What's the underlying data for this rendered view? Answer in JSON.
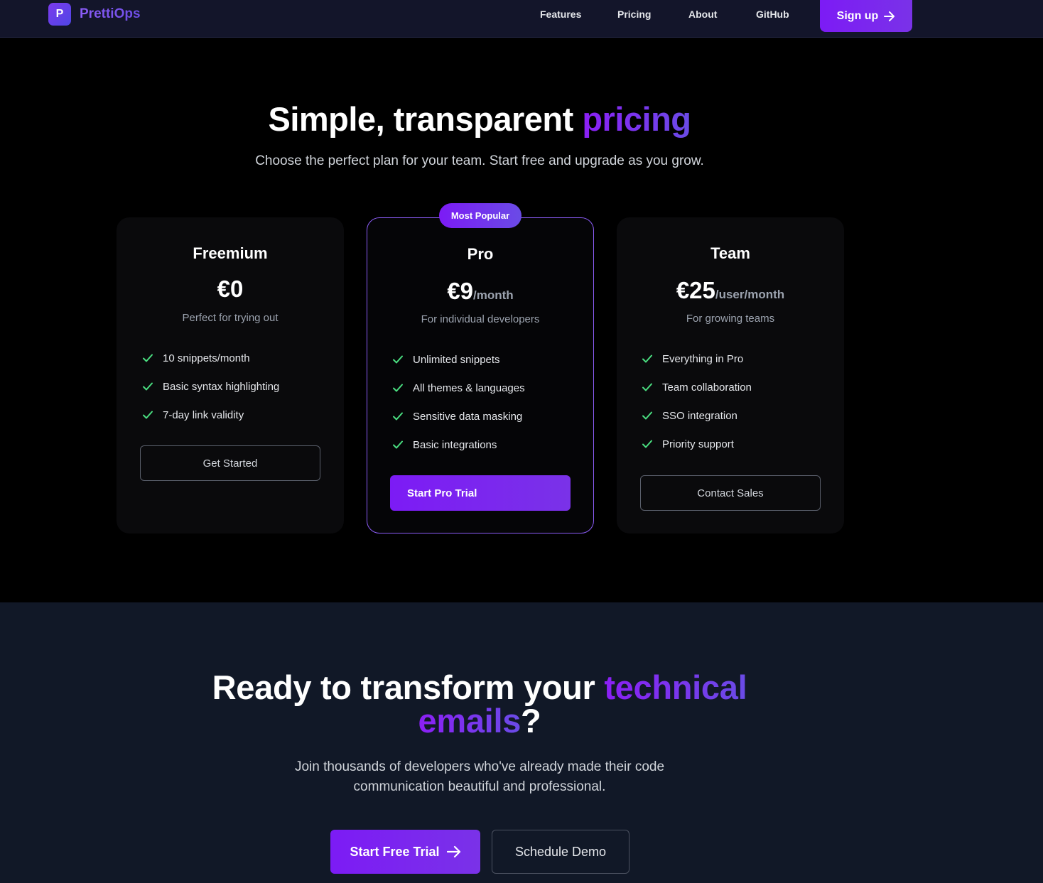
{
  "nav": {
    "logo_letter": "P",
    "brand": "PrettiOps",
    "links": [
      "Features",
      "Pricing",
      "About",
      "GitHub"
    ],
    "signup_label": "Sign up"
  },
  "hero": {
    "title_plain": "Simple, transparent ",
    "title_accent": "pricing",
    "subtitle": "Choose the perfect plan for your team. Start free and upgrade as you grow."
  },
  "plans": [
    {
      "name": "Freemium",
      "price": "€0",
      "period": "",
      "description": "Perfect for trying out",
      "features": [
        "10 snippets/month",
        "Basic syntax highlighting",
        "7-day link validity"
      ],
      "button": "Get Started"
    },
    {
      "name": "Pro",
      "badge": "Most Popular",
      "price": "€9",
      "period": "/month",
      "description": "For individual developers",
      "features": [
        "Unlimited snippets",
        "All themes & languages",
        "Sensitive data masking",
        "Basic integrations"
      ],
      "button": "Start Pro Trial"
    },
    {
      "name": "Team",
      "price": "€25",
      "period": "/user/month",
      "description": "For growing teams",
      "features": [
        "Everything in Pro",
        "Team collaboration",
        "SSO integration",
        "Priority support"
      ],
      "button": "Contact Sales"
    }
  ],
  "cta": {
    "title_plain": "Ready to transform your ",
    "title_accent_1": "technical",
    "title_accent_2": "emails",
    "title_end": "?",
    "subtitle": "Join thousands of developers who've already made their code communication beautiful and professional.",
    "primary_label": "Start Free Trial",
    "secondary_label": "Schedule Demo"
  },
  "colors": {
    "accent": "#7c1bf5",
    "accent_secondary": "#6a4be6",
    "check": "#4ade80",
    "nav_bg": "#13152a",
    "cta_bg": "#111827"
  }
}
